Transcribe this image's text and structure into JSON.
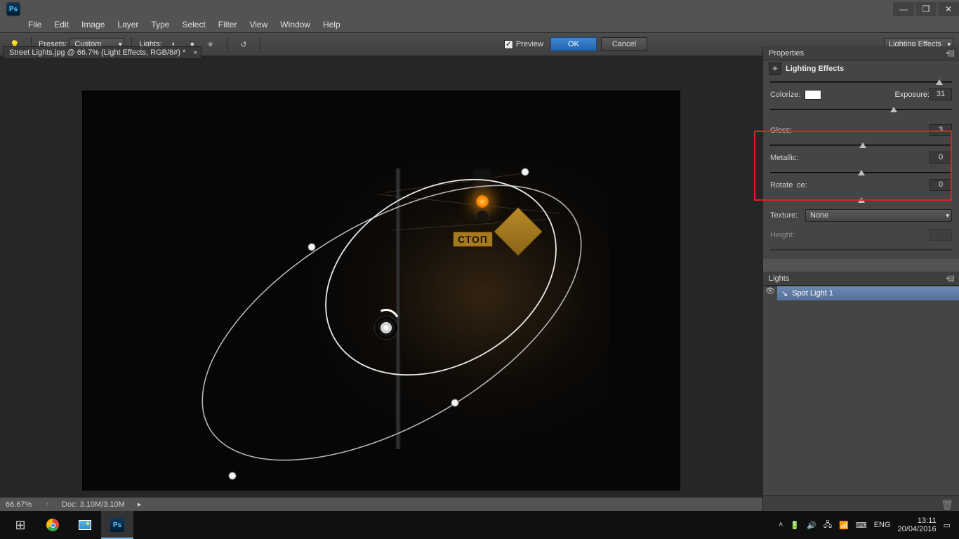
{
  "menu": {
    "file": "File",
    "edit": "Edit",
    "image": "Image",
    "layer": "Layer",
    "type": "Type",
    "select": "Select",
    "filter": "Filter",
    "view": "View",
    "window": "Window",
    "help": "Help"
  },
  "optbar": {
    "presets_label": "Presets:",
    "presets_value": "Custom",
    "lights_label": "Lights:",
    "preview_label": "Preview",
    "ok": "OK",
    "cancel": "Cancel",
    "fx_dd": "Lighting Effects"
  },
  "doc": {
    "tab": "Street Lights.jpg @ 66.7% (Light Effects, RGB/8#) *"
  },
  "scene": {
    "stop": "СТОП"
  },
  "status": {
    "zoom": "66.67%",
    "doc": "Doc: 3.10M/3.10M"
  },
  "props": {
    "tab": "Properties",
    "header": "Lighting Effects",
    "colorize_label": "Colorize:",
    "exposure_label": "Exposure:",
    "exposure_val": "31",
    "gloss_label": "Gloss:",
    "gloss_val": "3",
    "metallic_label": "Metallic:",
    "metallic_val": "0",
    "rotate_label": "Rotate",
    "ambience_label": "ce:",
    "ambience_val": "0",
    "texture_label": "Texture:",
    "texture_value": "None",
    "height_label": "Height:",
    "exposure_pct": 68,
    "gloss_pct": 51,
    "metallic_pct": 50,
    "ambience_pct": 50,
    "colorize_pct": 93
  },
  "lights": {
    "tab": "Lights",
    "item": "Spot Light 1"
  },
  "tray": {
    "lang": "ENG",
    "time": "13:11",
    "date": "20/04/2016"
  }
}
